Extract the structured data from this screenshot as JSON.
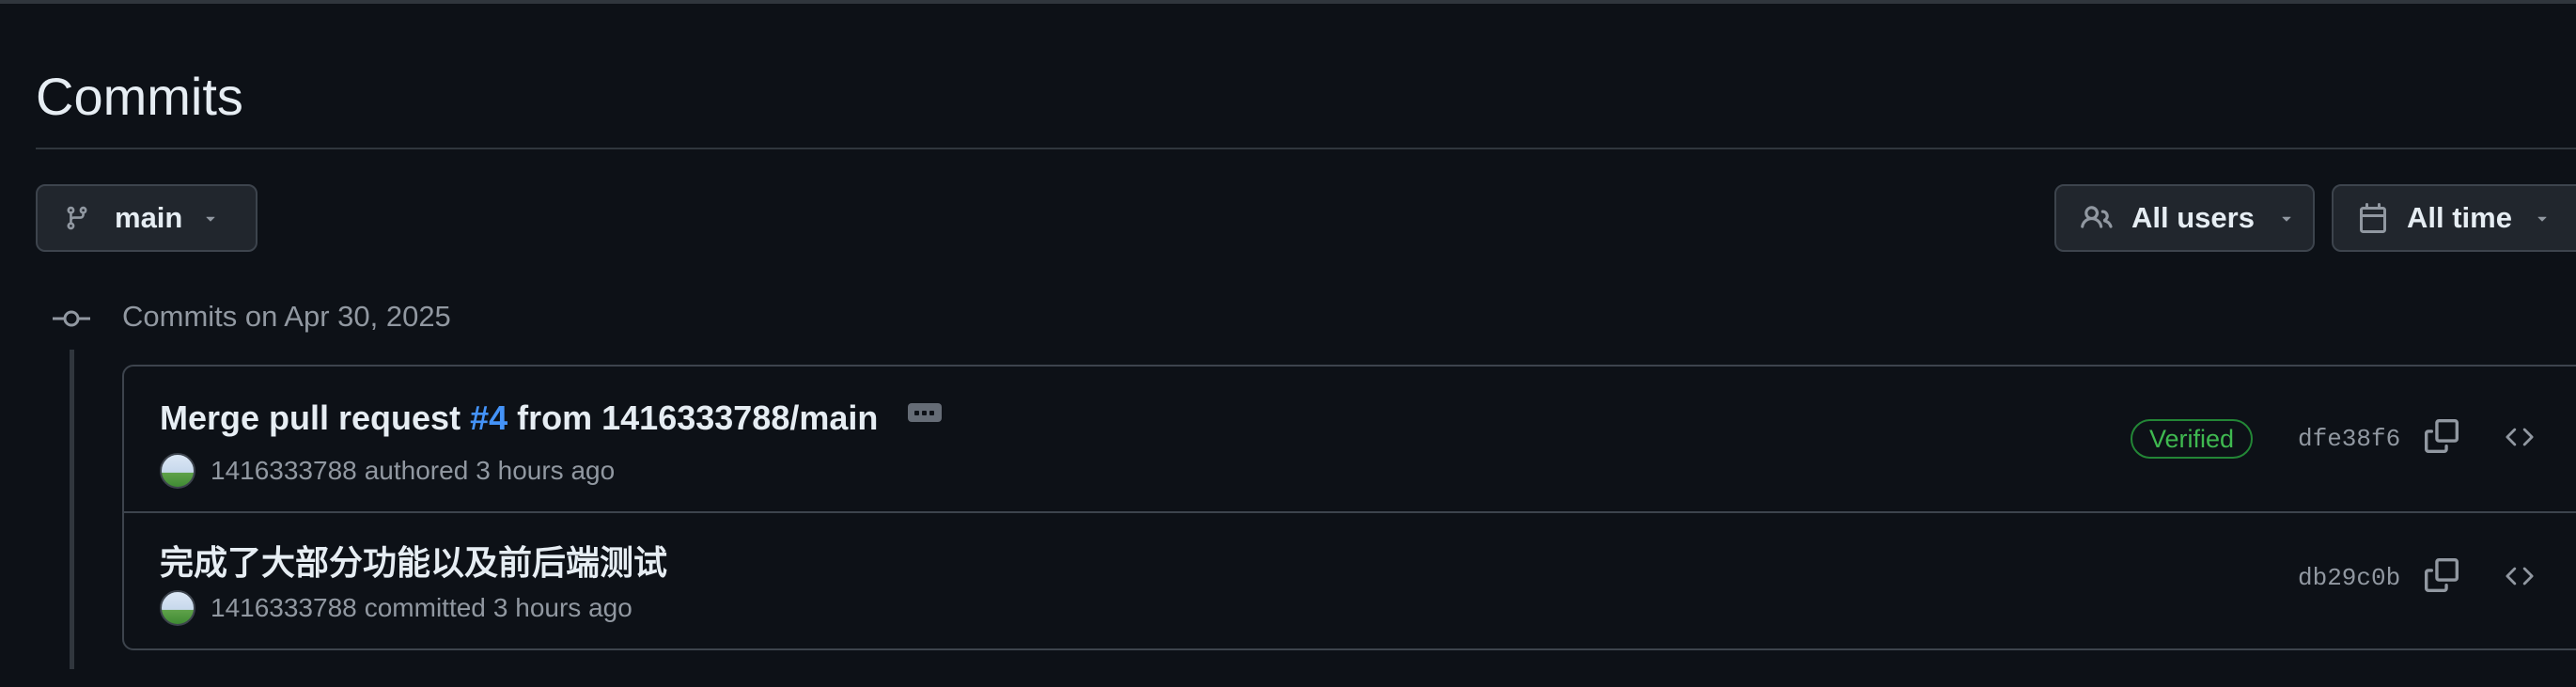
{
  "page": {
    "title": "Commits"
  },
  "filters": {
    "branch_label": "main",
    "users_label": "All users",
    "time_label": "All time"
  },
  "group": {
    "heading": "Commits on Apr 30, 2025"
  },
  "commits": [
    {
      "message_prefix": "Merge pull request ",
      "message_link": "#4",
      "message_suffix": " from 1416333788/main",
      "author": "1416333788",
      "action": "authored",
      "time": "3 hours ago",
      "badge": "Verified",
      "sha": "dfe38f6"
    },
    {
      "message": "完成了大部分功能以及前后端测试",
      "author": "1416333788",
      "action": "committed",
      "time": "3 hours ago",
      "sha": "db29c0b"
    }
  ],
  "icons": {
    "branch": "git-branch-icon",
    "people": "people-icon",
    "calendar": "calendar-icon",
    "caret": "triangle-down-icon",
    "commit": "git-commit-icon",
    "copy": "copy-icon",
    "browse": "code-icon"
  },
  "colors": {
    "background": "#0d1117",
    "link": "#4493f8",
    "verified": "#3fb950",
    "muted": "#9198a1",
    "border": "#3d444d"
  }
}
